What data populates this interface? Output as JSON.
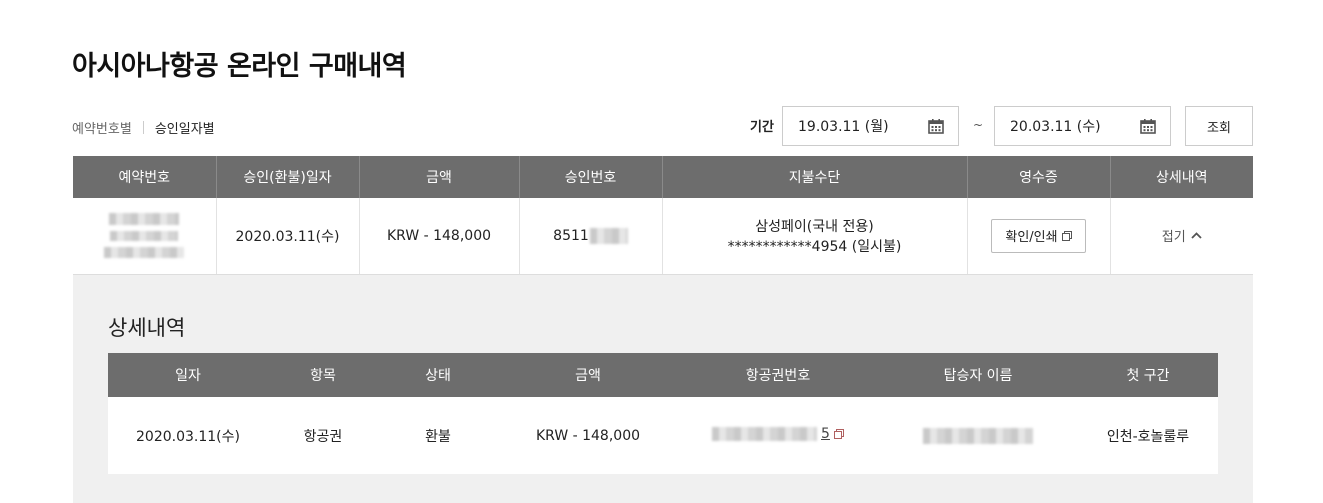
{
  "page": {
    "title": "아시아나항공 온라인 구매내역"
  },
  "filter": {
    "tabs": [
      {
        "label": "예약번호별"
      },
      {
        "label": "승인일자별"
      }
    ],
    "period_label": "기간",
    "date_from": "19.03.11 (월)",
    "date_to": "20.03.11 (수)",
    "separator": "~",
    "search_label": "조회"
  },
  "main_table": {
    "headers": [
      "예약번호",
      "승인(환불)일자",
      "금액",
      "승인번호",
      "지불수단",
      "영수증",
      "상세내역"
    ],
    "row": {
      "approval_date": "2020.03.11(수)",
      "amount": "KRW - 148,000",
      "approval_no_visible": "8511",
      "payment_line1": "삼성페이(국내 전용)",
      "payment_line2": "************4954  (일시불)",
      "receipt_label": "확인/인쇄",
      "fold_label": "접기"
    }
  },
  "detail": {
    "title": "상세내역",
    "headers": [
      "일자",
      "항목",
      "상태",
      "금액",
      "항공권번호",
      "탑승자 이름",
      "첫 구간"
    ],
    "row": {
      "date": "2020.03.11(수)",
      "item": "항공권",
      "status": "환불",
      "amount": "KRW - 148,000",
      "ticket_no_visible": "5",
      "first_segment": "인천-호놀룰루"
    }
  },
  "colors": {
    "header_bg": "#6d6d6d",
    "amount_red": "#b0272d",
    "panel_bg": "#f0f0f0"
  }
}
